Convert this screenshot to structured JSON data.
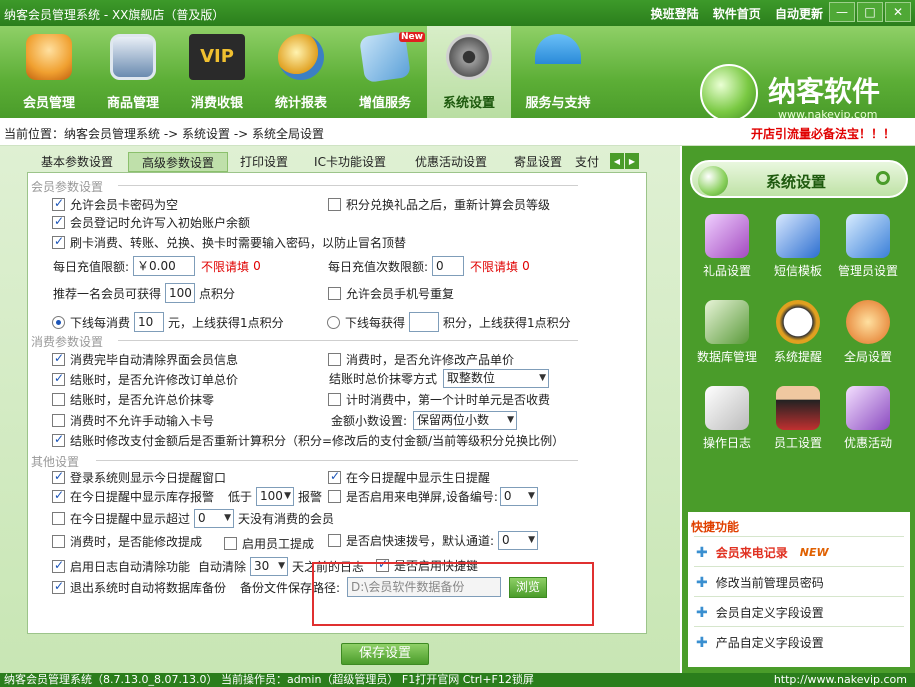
{
  "window": {
    "title": "纳客会员管理系统 - XX旗舰店（普及版）",
    "links": [
      "换班登陆",
      "软件首页",
      "自动更新"
    ],
    "buttons": [
      "—",
      "□",
      "✕"
    ]
  },
  "toolbar": {
    "items": [
      {
        "label": "会员管理",
        "icon": "members-icon",
        "color": "#f0a030"
      },
      {
        "label": "商品管理",
        "icon": "monitor-icon",
        "color": "#6a8bb0"
      },
      {
        "label": "消费收银",
        "icon": "vip-card-icon",
        "color": "#2a2a2a"
      },
      {
        "label": "统计报表",
        "icon": "clock-globe-icon",
        "color": "#3c7fc4"
      },
      {
        "label": "增值服务",
        "icon": "cards-icon",
        "color": "#5aa0d8",
        "badge": "New"
      },
      {
        "label": "系统设置",
        "icon": "gears-icon",
        "color": "#6a6a6a"
      },
      {
        "label": "服务与支持",
        "icon": "umbrella-icon",
        "color": "#2a8ad8"
      }
    ],
    "active_index": 5
  },
  "logo": {
    "name": "纳客软件",
    "url": "www.nakevip.com"
  },
  "breadcrumb": {
    "text": "当前位置：纳客会员管理系统 -> 系统设置 -> 系统全局设置",
    "promo": "开店引流量必备法宝！！！"
  },
  "tabs": [
    "基本参数设置",
    "高级参数设置",
    "打印设置",
    "IC卡功能设置",
    "优惠活动设置",
    "寄显设置",
    "支付"
  ],
  "tabs_active_index": 1,
  "tab_arrows": [
    "◀",
    "▶"
  ],
  "groups": {
    "member": "会员参数设置",
    "consume": "消费参数设置",
    "other": "其他设置"
  },
  "member": {
    "allow_empty_pwd": "允许会员卡密码为空",
    "recalc_level": "积分兑换礼品之后，重新计算会员等级",
    "allow_init_balance": "会员登记时允许写入初始账户余额",
    "require_pwd": "刷卡消费、转账、兑换、换卡时需要输入密码，以防止冒名顶替",
    "daily_limit_label": "每日充值限额:",
    "daily_limit_value": "￥0.00",
    "unlimited_label": "不限请填",
    "unlimited_value": "0",
    "daily_count_label": "每日充值次数限额:",
    "daily_count_value": "0",
    "unlimited2_label": "不限请填",
    "unlimited2_value": "0",
    "recommend_prefix": "推荐一名会员可获得",
    "recommend_value": "100",
    "recommend_suffix": "点积分",
    "allow_dup_phone": "允许会员手机号重复",
    "offline_spend_prefix": "下线每消费",
    "offline_spend_value": "10",
    "offline_spend_suffix": "元，上线获得1点积分",
    "offline_earn_prefix": "下线每获得",
    "offline_earn_value": "",
    "offline_earn_suffix": "积分，上线获得1点积分"
  },
  "consume": {
    "clear_info": "消费完毕自动清除界面会员信息",
    "allow_modify_price": "消费时，是否允许修改产品单价",
    "allow_modify_total": "结账时，是否允许修改订单总价",
    "rounding_label": "结账时总价抹零方式",
    "rounding_value": "取整数位",
    "allow_round_total": "结账时，是否允许总价抹零",
    "timed_first_unit": "计时消费中，第一个计时单元是否收费",
    "no_manual_card": "消费时不允许手动输入卡号",
    "decimal_label": "金额小数设置:",
    "decimal_value": "保留两位小数",
    "recalc_points": "结账时修改支付金额后是否重新计算积分（积分=修改后的支付金额/当前等级积分兑换比例）"
  },
  "other": {
    "show_reminder": "登录系统则显示今日提醒窗口",
    "show_birthday": "在今日提醒中显示生日提醒",
    "show_stock": "在今日提醒中显示库存报警",
    "below_label": "低于",
    "below_value": "100",
    "alarm_label": "报警",
    "caller_popup": "是否启用来电弹屏,设备编号:",
    "caller_device": "0",
    "show_exceed": "在今日提醒中显示超过",
    "exceed_value": "0",
    "no_consume_days": "天没有消费的会员",
    "modify_commission": "消费时，是否能修改提成",
    "staff_commission": "启用员工提成",
    "quick_dial": "是否启快速拨号，默认通道:",
    "dial_channel": "0",
    "log_cleanup": "启用日志自动清除功能",
    "auto_clear_label": "自动清除",
    "auto_clear_value": "30",
    "days_before": "天之前的日志",
    "shortcut_keys": "是否启用快捷键",
    "auto_backup": "退出系统时自动将数据库备份",
    "backup_path_label": "备份文件保存路径:",
    "backup_path_value": "D:\\会员软件数据备份",
    "browse": "浏览"
  },
  "save_button": "保存设置",
  "right_panel": {
    "title": "系统设置",
    "items": [
      {
        "label": "礼品设置",
        "icon": "gift-settings-icon",
        "color": "#a34ac0"
      },
      {
        "label": "短信模板",
        "icon": "sms-template-icon",
        "color": "#2d6fd0"
      },
      {
        "label": "管理员设置",
        "icon": "admin-settings-icon",
        "color": "#3a7fd8"
      },
      {
        "label": "数据库管理",
        "icon": "database-icon",
        "color": "#5a9a3a"
      },
      {
        "label": "系统提醒",
        "icon": "clock-icon",
        "color": "#e0a020"
      },
      {
        "label": "全局设置",
        "icon": "global-settings-icon",
        "color": "#e07020"
      },
      {
        "label": "操作日志",
        "icon": "operation-log-icon",
        "color": "#d0d0d0"
      },
      {
        "label": "员工设置",
        "icon": "staff-icon",
        "color": "#c03030"
      },
      {
        "label": "优惠活动",
        "icon": "promotion-icon",
        "color": "#8a4ac0"
      }
    ]
  },
  "quick": {
    "title": "快捷功能",
    "items": [
      "会员来电记录",
      "修改当前管理员密码",
      "会员自定义字段设置",
      "产品自定义字段设置"
    ],
    "new_badge": "NEW"
  },
  "status": {
    "left": "纳客会员管理系统（8.7.13.0_8.07.13.0） 当前操作员：admin（超级管理员） F1打开官网 Ctrl+F12锁屏",
    "right": "http://www.nakevip.com"
  }
}
